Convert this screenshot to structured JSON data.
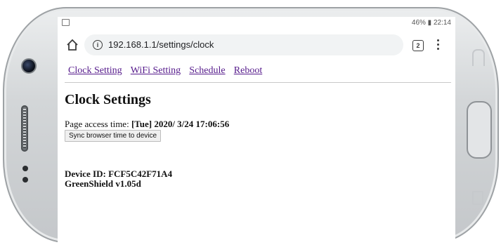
{
  "status_bar": {
    "right_text": "46% ▮ 22:14"
  },
  "browser": {
    "url": "192.168.1.1/settings/clock",
    "tab_count": "2"
  },
  "nav": {
    "items": [
      {
        "label": "Clock Setting"
      },
      {
        "label": "WiFi Setting"
      },
      {
        "label": "Schedule"
      },
      {
        "label": "Reboot"
      }
    ]
  },
  "page": {
    "title": "Clock Settings",
    "access_label": "Page access time: ",
    "access_value": "[Tue] 2020/ 3/24 17:06:56",
    "sync_button": "Sync browser time to device",
    "device_id": "Device ID: FCF5C42F71A4",
    "firmware": "GreenShield v1.05d"
  },
  "colors": {
    "link": "#551a8b",
    "phone_frame": "#c4c7ca"
  }
}
